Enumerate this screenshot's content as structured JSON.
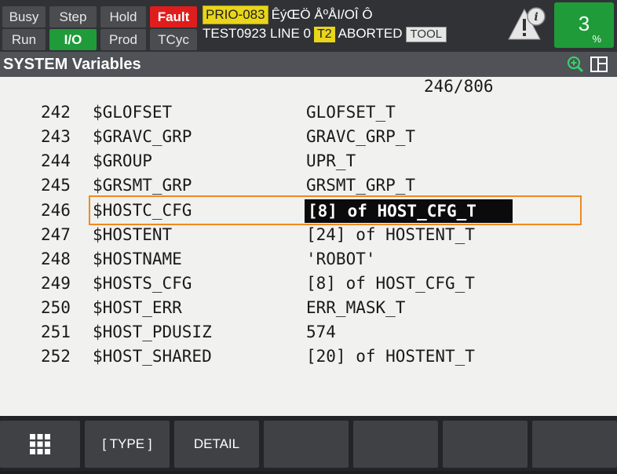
{
  "status": {
    "busy": "Busy",
    "step": "Step",
    "hold": "Hold",
    "fault": "Fault",
    "run": "Run",
    "io": "I/O",
    "prod": "Prod",
    "tcyc": "TCyc",
    "prio_tag": "PRIO-083",
    "prio_text": "ÊýŒÖ ÅºÅI/OÎ  Ô",
    "program_line": "TEST0923 LINE 0",
    "mode_badge": "T2",
    "state": "ABORTED",
    "tool_badge": "TOOL",
    "override_value": "3",
    "override_unit": "%",
    "colors": {
      "fault": "#e01d1d",
      "active": "#1f9b3a",
      "warning": "#e9d51a"
    }
  },
  "title_bar": {
    "title": "SYSTEM Variables",
    "zoom_icon": "zoom-in-icon",
    "split_icon": "split-screen-icon"
  },
  "content": {
    "page_counter": "246/806",
    "rows": [
      {
        "num": "242",
        "name": "$GLOFSET",
        "value": "GLOFSET_T"
      },
      {
        "num": "243",
        "name": "$GRAVC_GRP",
        "value": "GRAVC_GRP_T"
      },
      {
        "num": "244",
        "name": "$GROUP",
        "value": "UPR_T"
      },
      {
        "num": "245",
        "name": "$GRSMT_GRP",
        "value": "GRSMT_GRP_T"
      },
      {
        "num": "246",
        "name": "$HOSTC_CFG",
        "value": "[8] of HOST_CFG_T"
      },
      {
        "num": "247",
        "name": "$HOSTENT",
        "value": "[24] of HOSTENT_T"
      },
      {
        "num": "248",
        "name": "$HOSTNAME",
        "value": "'ROBOT'"
      },
      {
        "num": "249",
        "name": "$HOSTS_CFG",
        "value": "[8] of HOST_CFG_T"
      },
      {
        "num": "250",
        "name": "$HOST_ERR",
        "value": "ERR_MASK_T"
      },
      {
        "num": "251",
        "name": "$HOST_PDUSIZ",
        "value": "574"
      },
      {
        "num": "252",
        "name": "$HOST_SHARED",
        "value": "[20] of HOSTENT_T"
      }
    ],
    "selected_index": 4,
    "highlight_color": "#f08a1e"
  },
  "fkeys": {
    "menu_icon": "grid-menu-icon",
    "f1": "[ TYPE ]",
    "f2": "DETAIL",
    "f3": "",
    "f4": "",
    "f5": "",
    "f6": ""
  }
}
